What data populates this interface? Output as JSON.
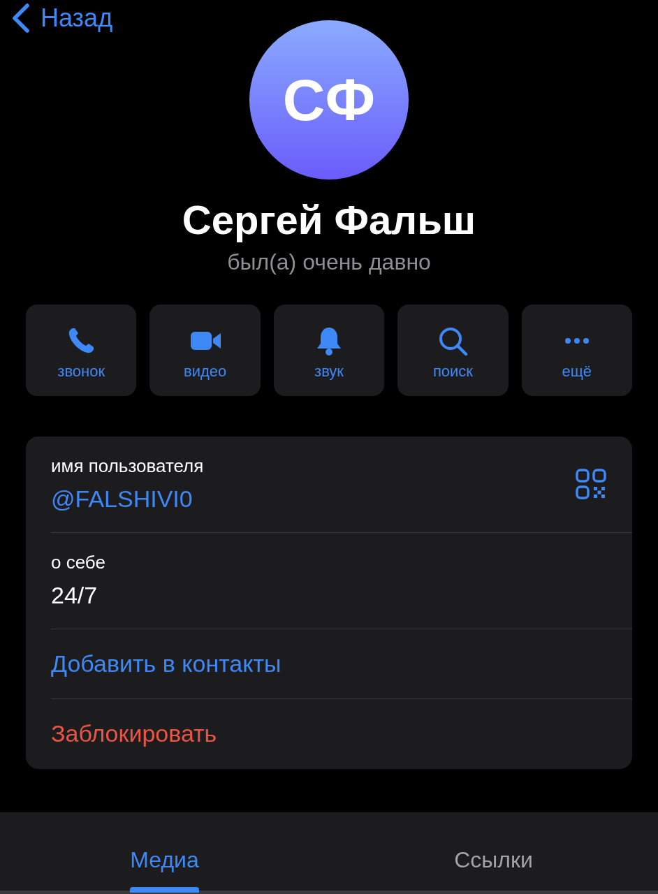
{
  "nav": {
    "back_label": "Назад"
  },
  "profile": {
    "initials": "СФ",
    "name": "Сергей Фальш",
    "status": "был(а) очень давно"
  },
  "actions": [
    {
      "kind": "phone",
      "label": "звонок"
    },
    {
      "kind": "video",
      "label": "видео"
    },
    {
      "kind": "bell",
      "label": "звук"
    },
    {
      "kind": "search",
      "label": "поиск"
    },
    {
      "kind": "more",
      "label": "ещё"
    }
  ],
  "info": {
    "username": {
      "label": "имя пользователя",
      "value": "@FALSHIVI0"
    },
    "about": {
      "label": "о себе",
      "value": "24/7"
    },
    "links": [
      {
        "kind": "link",
        "label": "Добавить в контакты"
      },
      {
        "kind": "danger",
        "label": "Заблокировать"
      }
    ]
  },
  "tabs": [
    {
      "label": "Медиа",
      "selected": true
    },
    {
      "label": "Ссылки",
      "selected": false
    }
  ]
}
